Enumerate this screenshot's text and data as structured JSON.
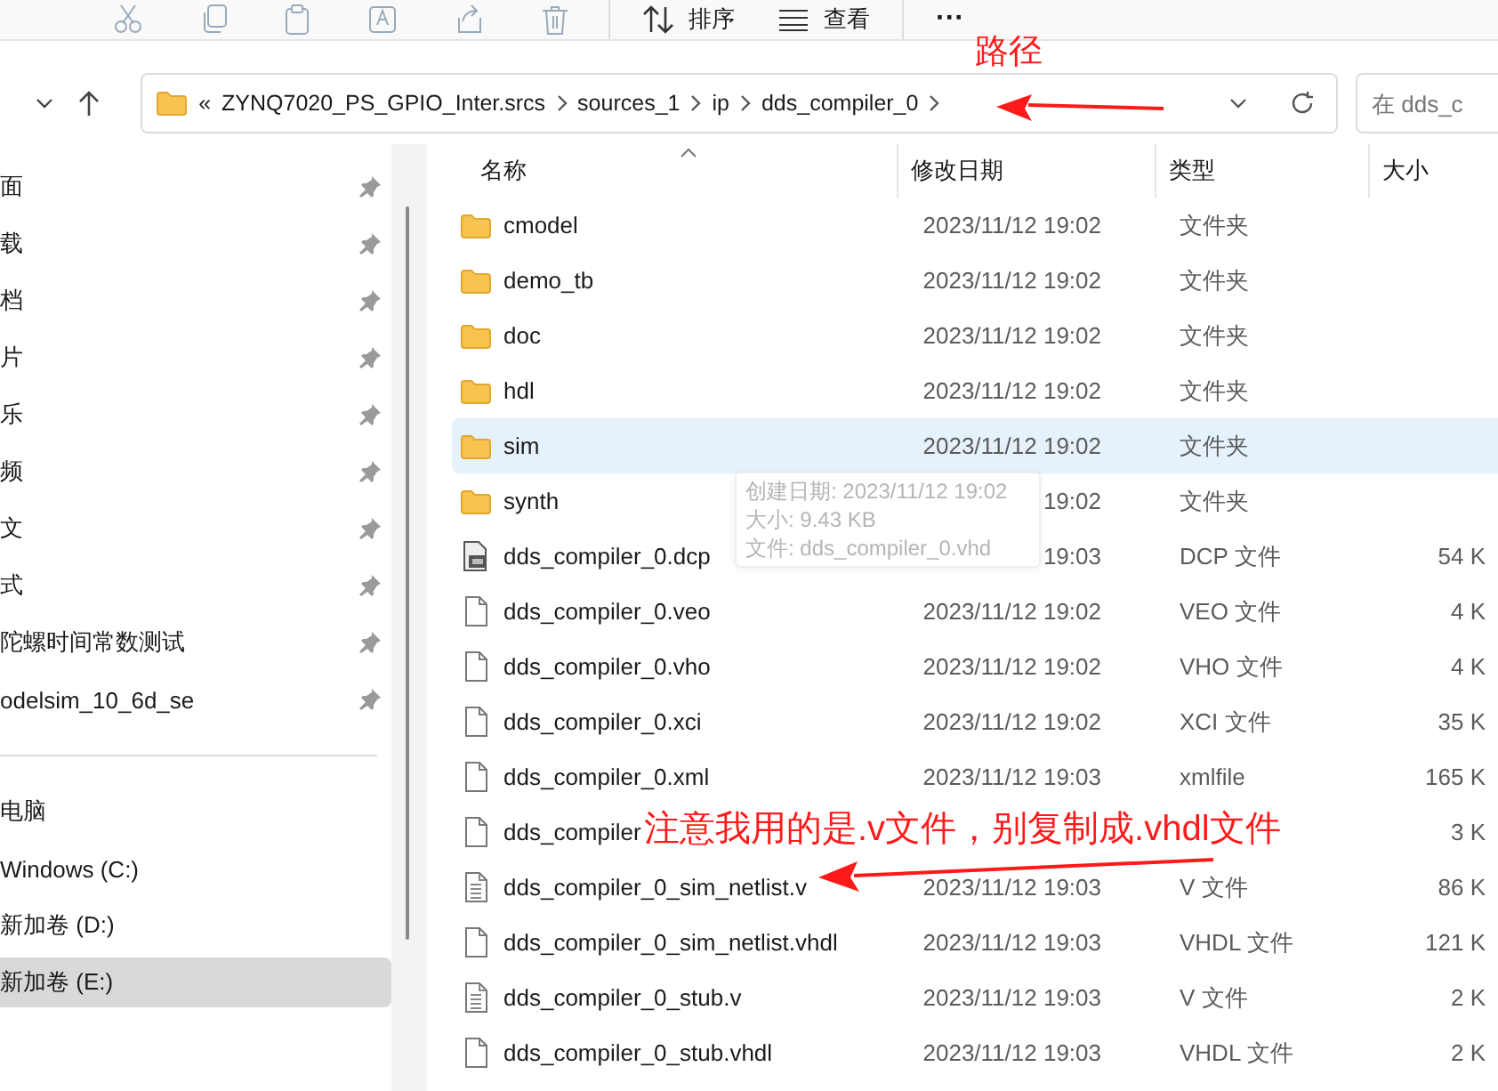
{
  "toolbar": {
    "items": [
      {
        "kind": "cut"
      },
      {
        "kind": "copy"
      },
      {
        "kind": "paste"
      },
      {
        "kind": "rename"
      },
      {
        "kind": "share"
      },
      {
        "kind": "delete"
      },
      {
        "kind": "sort",
        "label": "排序"
      },
      {
        "kind": "view",
        "label": "查看"
      },
      {
        "kind": "more",
        "label": "···"
      }
    ]
  },
  "address": {
    "overflow": "«",
    "parts": [
      "ZYNQ7020_PS_GPIO_Inter.srcs",
      "sources_1",
      "ip",
      "dds_compiler_0"
    ],
    "search_placeholder": "在 dds_c"
  },
  "sidebar": {
    "items": [
      {
        "label": "面",
        "pinned": true,
        "selected": false
      },
      {
        "label": "载",
        "pinned": true,
        "selected": false
      },
      {
        "label": "档",
        "pinned": true,
        "selected": false
      },
      {
        "label": "片",
        "pinned": true,
        "selected": false
      },
      {
        "label": "乐",
        "pinned": true,
        "selected": false
      },
      {
        "label": "频",
        "pinned": true,
        "selected": false
      },
      {
        "label": "文",
        "pinned": true,
        "selected": false
      },
      {
        "label": "式",
        "pinned": true,
        "selected": false
      },
      {
        "label": "陀螺时间常数测试",
        "pinned": true,
        "selected": false
      },
      {
        "label": "odelsim_10_6d_se",
        "pinned": true,
        "selected": false
      },
      {
        "kind": "divider"
      },
      {
        "label": "电脑",
        "pinned": false,
        "selected": false
      },
      {
        "label": "Windows (C:)",
        "pinned": false,
        "selected": false
      },
      {
        "label": "新加卷 (D:)",
        "pinned": false,
        "selected": false
      },
      {
        "label": "新加卷 (E:)",
        "pinned": false,
        "selected": true
      }
    ]
  },
  "table": {
    "columns": [
      "名称",
      "修改日期",
      "类型",
      "大小"
    ],
    "rows": [
      {
        "kind": "folder",
        "name": "cmodel",
        "date": "2023/11/12 19:02",
        "type": "文件夹",
        "selected": false
      },
      {
        "kind": "folder",
        "name": "demo_tb",
        "date": "2023/11/12 19:02",
        "type": "文件夹",
        "selected": false
      },
      {
        "kind": "folder",
        "name": "doc",
        "date": "2023/11/12 19:02",
        "type": "文件夹",
        "selected": false
      },
      {
        "kind": "folder",
        "name": "hdl",
        "date": "2023/11/12 19:02",
        "type": "文件夹",
        "selected": false
      },
      {
        "kind": "folder",
        "name": "sim",
        "date": "2023/11/12 19:02",
        "type": "文件夹",
        "selected": true
      },
      {
        "kind": "folder",
        "name": "synth",
        "date": "19:02",
        "type": "文件夹",
        "selected": false
      },
      {
        "kind": "dcp",
        "name": "dds_compiler_0.dcp",
        "date": "19:03",
        "type": "DCP 文件",
        "size": "54 K",
        "selected": false
      },
      {
        "kind": "file",
        "name": "dds_compiler_0.veo",
        "date": "2023/11/12 19:02",
        "type": "VEO 文件",
        "size": "4 K",
        "selected": false
      },
      {
        "kind": "file",
        "name": "dds_compiler_0.vho",
        "date": "2023/11/12 19:02",
        "type": "VHO 文件",
        "size": "4 K",
        "selected": false
      },
      {
        "kind": "file",
        "name": "dds_compiler_0.xci",
        "date": "2023/11/12 19:02",
        "type": "XCI 文件",
        "size": "35 K",
        "selected": false
      },
      {
        "kind": "file",
        "name": "dds_compiler_0.xml",
        "date": "2023/11/12 19:03",
        "type": "xmlfile",
        "size": "165 K",
        "selected": false
      },
      {
        "kind": "file",
        "name": "dds_compiler",
        "size": "3 K",
        "selected": false
      },
      {
        "kind": "text",
        "name": "dds_compiler_0_sim_netlist.v",
        "date": "2023/11/12 19:03",
        "type": "V 文件",
        "size": "86 K",
        "selected": false
      },
      {
        "kind": "file",
        "name": "dds_compiler_0_sim_netlist.vhdl",
        "date": "2023/11/12 19:03",
        "type": "VHDL 文件",
        "size": "121 K",
        "selected": false
      },
      {
        "kind": "text",
        "name": "dds_compiler_0_stub.v",
        "date": "2023/11/12 19:03",
        "type": "V 文件",
        "size": "2 K",
        "selected": false
      },
      {
        "kind": "file",
        "name": "dds_compiler_0_stub.vhdl",
        "date": "2023/11/12 19:03",
        "type": "VHDL 文件",
        "size": "2 K",
        "selected": false
      }
    ]
  },
  "tooltip": {
    "lines": [
      "创建日期: 2023/11/12 19:02",
      "大小: 9.43 KB",
      "文件: dds_compiler_0.vhd"
    ]
  },
  "annotations": [
    {
      "text": "路径"
    },
    {
      "text": "注意我用的是.v文件，别复制成.vhdl文件"
    }
  ]
}
